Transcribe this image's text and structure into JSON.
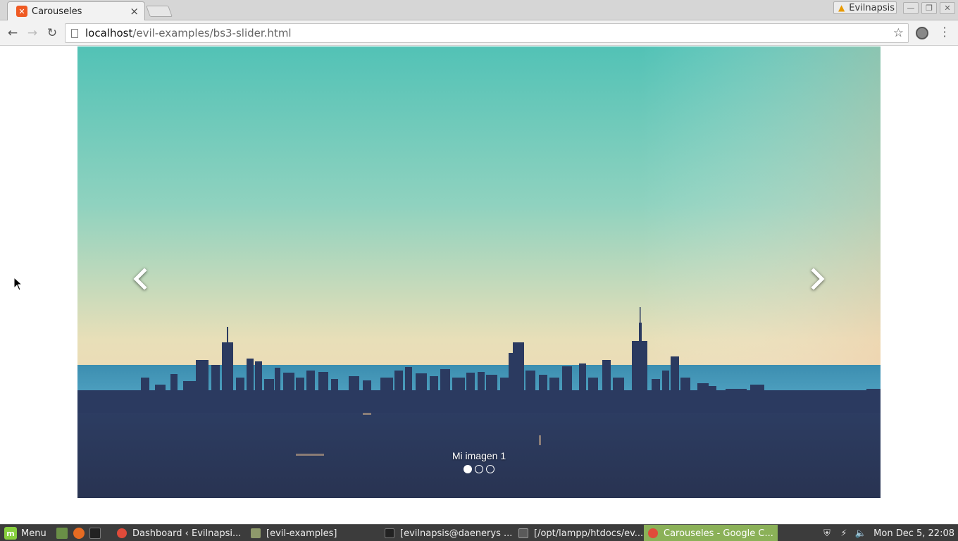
{
  "browser": {
    "tab": {
      "title": "Carouseles",
      "favicon": "xampp-icon",
      "close": "×"
    },
    "profile": {
      "name": "Evilnapsis",
      "icon": "warning-icon"
    },
    "window_controls": [
      "minimize-icon",
      "maximize-icon",
      "close-icon"
    ],
    "nav": {
      "back": "←",
      "forward": "→",
      "reload": "↻"
    },
    "address": {
      "host": "localhost",
      "path": "/evil-examples/bs3-slider.html"
    }
  },
  "carousel": {
    "caption": "Mi imagen 1",
    "slide_count": 3,
    "active_index": 0,
    "controls": {
      "prev": "chevron-left-icon",
      "next": "chevron-right-icon"
    }
  },
  "taskbar": {
    "menu_label": "Menu",
    "windows": [
      {
        "label": "Dashboard ‹ Evilnapsi...",
        "icon": "chrome-icon"
      },
      {
        "label": "[evil-examples]",
        "icon": "folder-icon"
      },
      {
        "label": "[evilnapsis@daenerys ...",
        "icon": "terminal-icon"
      },
      {
        "label": "[/opt/lampp/htdocs/ev...",
        "icon": "editor-icon"
      },
      {
        "label": "Carouseles - Google C...",
        "icon": "chrome-icon",
        "active": true
      }
    ],
    "clock": "Mon Dec  5, 22:08"
  },
  "colors": {
    "sky_top": "#56c3b8",
    "sky_bottom": "#f0d9b8",
    "skyline": "#27345a",
    "taskbar_active": "#8bb158"
  }
}
